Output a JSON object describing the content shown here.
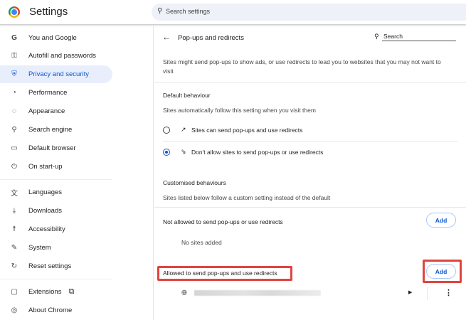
{
  "header": {
    "title": "Settings",
    "search_placeholder": "Search settings"
  },
  "sidebar": {
    "items": [
      {
        "label": "You and Google",
        "icon": "google-icon"
      },
      {
        "label": "Autofill and passwords",
        "icon": "key-icon"
      },
      {
        "label": "Privacy and security",
        "icon": "shield-icon",
        "active": true
      },
      {
        "label": "Performance",
        "icon": "speedometer-icon"
      },
      {
        "label": "Appearance",
        "icon": "palette-icon"
      },
      {
        "label": "Search engine",
        "icon": "search-icon"
      },
      {
        "label": "Default browser",
        "icon": "browser-icon"
      },
      {
        "label": "On start-up",
        "icon": "power-icon"
      },
      {
        "label": "Languages",
        "icon": "translate-icon"
      },
      {
        "label": "Downloads",
        "icon": "download-icon"
      },
      {
        "label": "Accessibility",
        "icon": "accessibility-icon"
      },
      {
        "label": "System",
        "icon": "wrench-icon"
      },
      {
        "label": "Reset settings",
        "icon": "reset-icon"
      },
      {
        "label": "Extensions",
        "icon": "puzzle-icon"
      },
      {
        "label": "About Chrome",
        "icon": "chrome-icon"
      }
    ]
  },
  "main": {
    "title": "Pop-ups and redirects",
    "search_placeholder": "Search",
    "description_1": "Sites might send pop-ups to show ads, or use redirects to lead you to websites that you may not want to",
    "description_2": "visit",
    "default_heading": "Default behaviour",
    "default_sub": "Sites automatically follow this setting when you visit them",
    "option_allow": "Sites can send pop-ups and use redirects",
    "option_block": "Don't allow sites to send pop-ups or use redirects",
    "selected_option": "block",
    "custom_heading": "Customised behaviours",
    "custom_sub": "Sites listed below follow a custom setting instead of the default",
    "not_allowed_label": "Not allowed to send pop-ups or use redirects",
    "add_label": "Add",
    "no_sites": "No sites added",
    "allowed_label": "Allowed to send pop-ups and use redirects",
    "add_label_2": "Add"
  },
  "colors": {
    "accent": "#0b57d0",
    "highlight": "#e0443e"
  }
}
